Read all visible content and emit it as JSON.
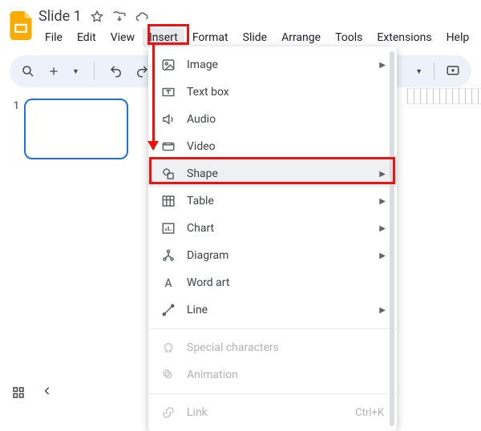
{
  "doc": {
    "title": "Slide 1"
  },
  "menubar": [
    "File",
    "Edit",
    "View",
    "Insert",
    "Format",
    "Slide",
    "Arrange",
    "Tools",
    "Extensions",
    "Help"
  ],
  "menubar_open_index": 3,
  "slide": {
    "number": "1"
  },
  "menu": {
    "image": "Image",
    "textbox": "Text box",
    "audio": "Audio",
    "video": "Video",
    "shape": "Shape",
    "table": "Table",
    "chart": "Chart",
    "diagram": "Diagram",
    "wordart": "Word art",
    "line": "Line",
    "special": "Special characters",
    "animation": "Animation",
    "link": "Link",
    "link_shortcut": "Ctrl+K"
  }
}
